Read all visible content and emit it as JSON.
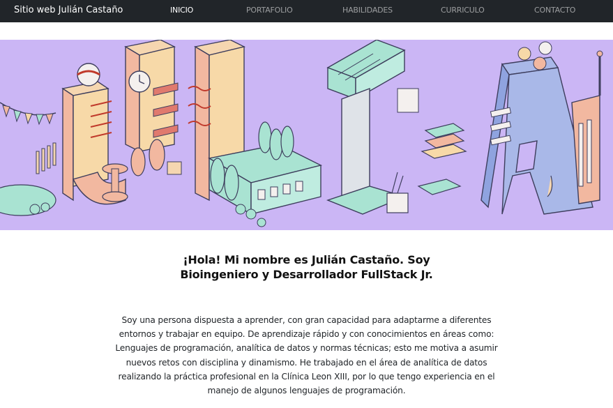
{
  "navbar": {
    "brand": "Sitio web Julián Castaño",
    "links": [
      "INICIO",
      "PORTAFOLIO",
      "HABILIDADES",
      "CURRICULO",
      "CONTACTO"
    ],
    "active_link": "INICIO",
    "background": "#212529"
  },
  "banner": {
    "illustration": "isometric-letters-julia-city",
    "background": "#cbb6f5"
  },
  "intro": {
    "headline": "¡Hola! Mi nombre es Julián Castaño. Soy Bioingeniero y Desarrollador FullStack Jr.",
    "bio": "Soy una persona dispuesta a aprender, con gran capacidad para adaptarme a diferentes entornos y trabajar en equipo. De aprendizaje rápido y con conocimientos en áreas como: Lenguajes de programación, analítica de datos y normas técnicas; esto me motiva a asumir nuevos retos con disciplina y dinamismo. He trabajado en el área de analítica de datos realizando la práctica profesional en la Clínica Leon XIII, por lo que tengo experiencia en el manejo de algunos lenguajes de programación."
  }
}
